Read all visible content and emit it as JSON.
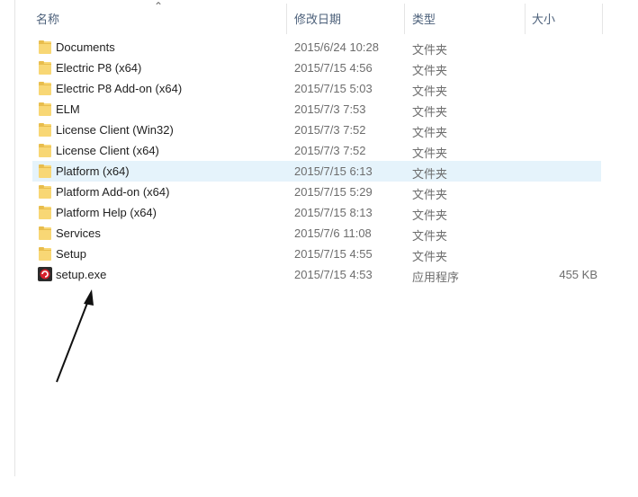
{
  "header": {
    "name": "名称",
    "date": "修改日期",
    "type": "类型",
    "size": "大小",
    "sort_icon": "chevron-up-icon"
  },
  "files": [
    {
      "name": "Documents",
      "date": "2015/6/24 10:28",
      "type": "文件夹",
      "size": "",
      "icon": "folder-icon",
      "selected": false
    },
    {
      "name": "Electric P8 (x64)",
      "date": "2015/7/15 4:56",
      "type": "文件夹",
      "size": "",
      "icon": "folder-icon",
      "selected": false
    },
    {
      "name": "Electric P8 Add-on (x64)",
      "date": "2015/7/15 5:03",
      "type": "文件夹",
      "size": "",
      "icon": "folder-icon",
      "selected": false
    },
    {
      "name": "ELM",
      "date": "2015/7/3 7:53",
      "type": "文件夹",
      "size": "",
      "icon": "folder-icon",
      "selected": false
    },
    {
      "name": "License Client (Win32)",
      "date": "2015/7/3 7:52",
      "type": "文件夹",
      "size": "",
      "icon": "folder-icon",
      "selected": false
    },
    {
      "name": "License Client (x64)",
      "date": "2015/7/3 7:52",
      "type": "文件夹",
      "size": "",
      "icon": "folder-icon",
      "selected": false
    },
    {
      "name": "Platform (x64)",
      "date": "2015/7/15 6:13",
      "type": "文件夹",
      "size": "",
      "icon": "folder-icon",
      "selected": true
    },
    {
      "name": "Platform Add-on (x64)",
      "date": "2015/7/15 5:29",
      "type": "文件夹",
      "size": "",
      "icon": "folder-icon",
      "selected": false
    },
    {
      "name": "Platform Help (x64)",
      "date": "2015/7/15 8:13",
      "type": "文件夹",
      "size": "",
      "icon": "folder-icon",
      "selected": false
    },
    {
      "name": "Services",
      "date": "2015/7/6 11:08",
      "type": "文件夹",
      "size": "",
      "icon": "folder-icon",
      "selected": false
    },
    {
      "name": "Setup",
      "date": "2015/7/15 4:55",
      "type": "文件夹",
      "size": "",
      "icon": "folder-icon",
      "selected": false
    },
    {
      "name": "setup.exe",
      "date": "2015/7/15 4:53",
      "type": "应用程序",
      "size": "455 KB",
      "icon": "setup-exe-icon",
      "selected": false
    }
  ],
  "colors": {
    "selected_row": "#e5f3fb",
    "folder_yellow": "#f8d775",
    "exe_red": "#d8202c",
    "arrow": "#111111"
  }
}
